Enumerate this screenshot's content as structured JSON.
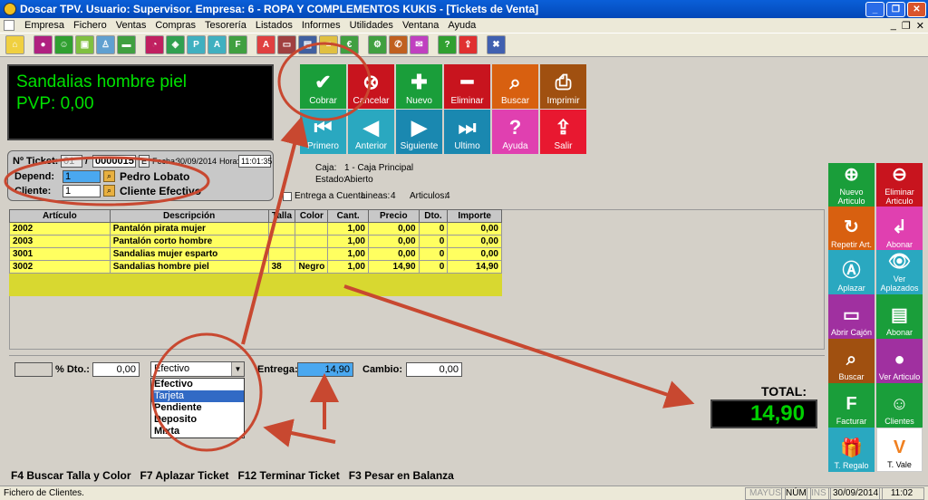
{
  "window": {
    "title": "Doscar TPV. Usuario: Supervisor. Empresa: 6 - ROPA Y COMPLEMENTOS KUKIS - [Tickets de Venta]"
  },
  "menu": [
    "Empresa",
    "Fichero",
    "Ventas",
    "Compras",
    "Tesorería",
    "Listados",
    "Informes",
    "Utilidades",
    "Ventana",
    "Ayuda"
  ],
  "display": {
    "line1": "Sandalias hombre piel",
    "line2": "PVP: 0,00"
  },
  "actions": {
    "cobrar": "Cobrar",
    "cancelar": "Cancelar",
    "nuevo": "Nuevo",
    "eliminar": "Eliminar",
    "buscar": "Buscar",
    "imprimir": "Imprimir",
    "primero": "Primero",
    "anterior": "Anterior",
    "siguiente": "Siguiente",
    "ultimo": "Ultimo",
    "ayuda": "Ayuda",
    "salir": "Salir"
  },
  "ticket": {
    "label": "Nº Ticket:",
    "serie": "01",
    "sep": "/",
    "numero": "0000015",
    "e_label": "E",
    "fecha_label": "Fecha:",
    "fecha": "30/09/2014",
    "hora_label": "Hora:",
    "hora": "11:01:35",
    "depend_label": "Depend:",
    "depend_code": "1",
    "depend_name": "Pedro Lobato",
    "cliente_label": "Cliente:",
    "cliente_code": "1",
    "cliente_name": "Cliente Efectivo"
  },
  "info": {
    "caja_label": "Caja:",
    "caja": "1 - Caja Principal",
    "estado_label": "Estado:",
    "estado": "Abierto",
    "entrega_cuenta": "Entrega a Cuenta",
    "lineas_label": "Lineas:",
    "lineas": "4",
    "articulos_label": "Articulos:",
    "articulos": "4"
  },
  "table": {
    "headers": [
      "Artículo",
      "Descripción",
      "Talla",
      "Color",
      "Cant.",
      "Precio",
      "Dto.",
      "Importe"
    ],
    "rows": [
      [
        "2002",
        "Pantalón pirata mujer",
        "",
        "",
        "1,00",
        "0,00",
        "0",
        "0,00"
      ],
      [
        "2003",
        "Pantalón corto hombre",
        "",
        "",
        "1,00",
        "0,00",
        "0",
        "0,00"
      ],
      [
        "3001",
        "Sandalias mujer esparto",
        "",
        "",
        "1,00",
        "0,00",
        "0",
        "0,00"
      ],
      [
        "3002",
        "Sandalias hombre piel",
        "38",
        "Negro",
        "1,00",
        "14,90",
        "0",
        "14,90"
      ]
    ]
  },
  "payment": {
    "dto_label": "% Dto.:",
    "dto": "0,00",
    "method": "Efectivo",
    "options": [
      "Efectivo",
      "Tarjeta",
      "Pendiente",
      "Deposito",
      "Mixta"
    ],
    "entrega_label": "Entrega:",
    "entrega": "14,90",
    "cambio_label": "Cambio:",
    "cambio": "0,00"
  },
  "side": {
    "nuevo_articulo": "Nuevo Articulo",
    "eliminar_articulo": "Eliminar Articulo",
    "repetir": "Repetir Art.",
    "abonar": "Abonar",
    "aplazar": "Aplazar",
    "ver_aplazados": "Ver Aplazados",
    "abrir_cajon": "Abrir Cajón",
    "abonar2": "Abonar",
    "buscar": "Buscar",
    "ver_articulo": "Ver Articulo",
    "facturar": "Facturar",
    "clientes": "Clientes",
    "regalo": "T. Regalo",
    "vale": "T. Vale"
  },
  "total": {
    "label": "TOTAL:",
    "value": "14,90"
  },
  "shortcuts": "F4 Buscar Talla y Color   F7 Aplazar Ticket   F12 Terminar Ticket   F3 Pesar en Balanza",
  "status": {
    "left": "Fichero de Clientes.",
    "mayus": "MAYÚS",
    "num": "NÚM",
    "ins": "INS",
    "date": "30/09/2014",
    "time": "11:02"
  },
  "colors": {
    "green": "#1a9e3a",
    "red": "#c8141e",
    "teal": "#2aa8c0",
    "pink": "#e040b0",
    "orange": "#d86010",
    "purple": "#a030a0",
    "brown": "#a05010",
    "annotation": "#c84830"
  }
}
